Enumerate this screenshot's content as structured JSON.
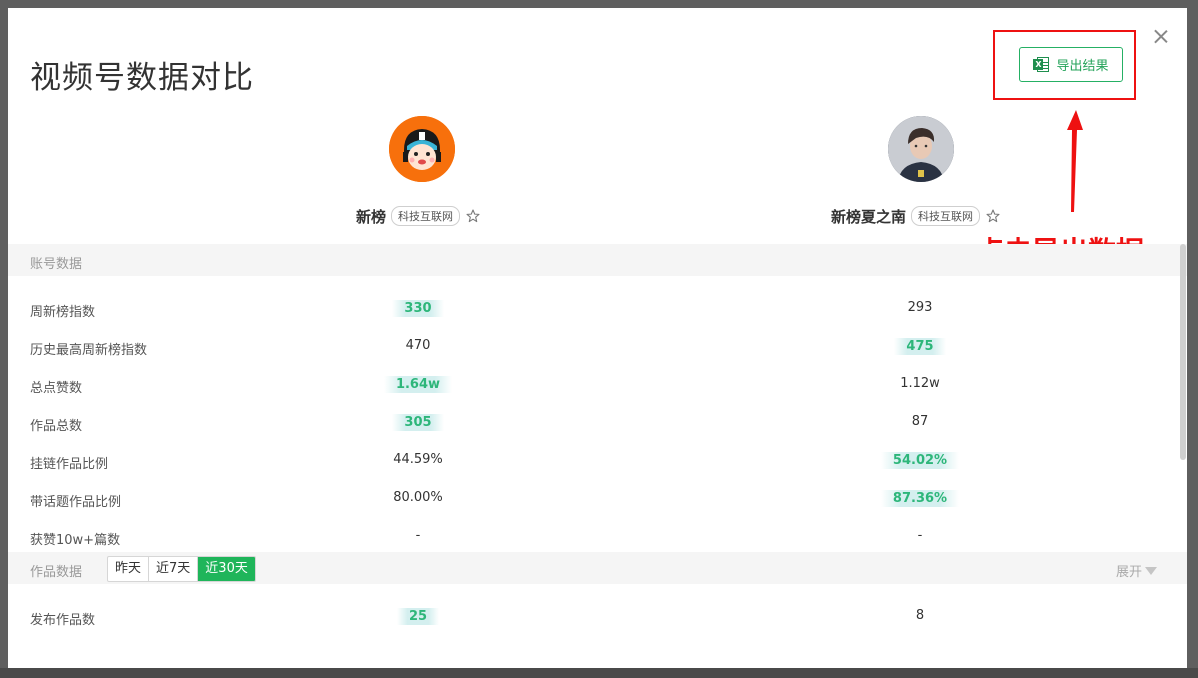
{
  "modal": {
    "title": "视频号数据对比",
    "export_label": "导出结果"
  },
  "annotation": {
    "text": "点击导出数据",
    "color": "#ee1111"
  },
  "accounts": [
    {
      "name": "新榜",
      "tag": "科技互联网",
      "avatar_bg": "#f7700c"
    },
    {
      "name": "新榜夏之南",
      "tag": "科技互联网",
      "avatar_bg": "#3a4454"
    }
  ],
  "sections": {
    "account": {
      "label": "账号数据"
    },
    "works": {
      "label": "作品数据",
      "expand_label": "展开",
      "tabs": [
        "昨天",
        "近7天",
        "近30天"
      ],
      "active_tab": "近30天"
    }
  },
  "account_metrics": [
    {
      "label": "周新榜指数",
      "a": "330",
      "b": "293",
      "winner": "a"
    },
    {
      "label": "历史最高周新榜指数",
      "a": "470",
      "b": "475",
      "winner": "b"
    },
    {
      "label": "总点赞数",
      "a": "1.64w",
      "b": "1.12w",
      "winner": "a"
    },
    {
      "label": "作品总数",
      "a": "305",
      "b": "87",
      "winner": "a"
    },
    {
      "label": "挂链作品比例",
      "a": "44.59%",
      "b": "54.02%",
      "winner": "b"
    },
    {
      "label": "带话题作品比例",
      "a": "80.00%",
      "b": "87.36%",
      "winner": "b"
    },
    {
      "label": "获赞10w+篇数",
      "a": "-",
      "b": "-",
      "winner": ""
    }
  ],
  "work_metrics": [
    {
      "label": "发布作品数",
      "a": "25",
      "b": "8",
      "winner": "a"
    }
  ],
  "colors": {
    "accent_green": "#1fb55a",
    "highlight_bg": "#d4efef",
    "highlight_text": "#2db67a"
  }
}
